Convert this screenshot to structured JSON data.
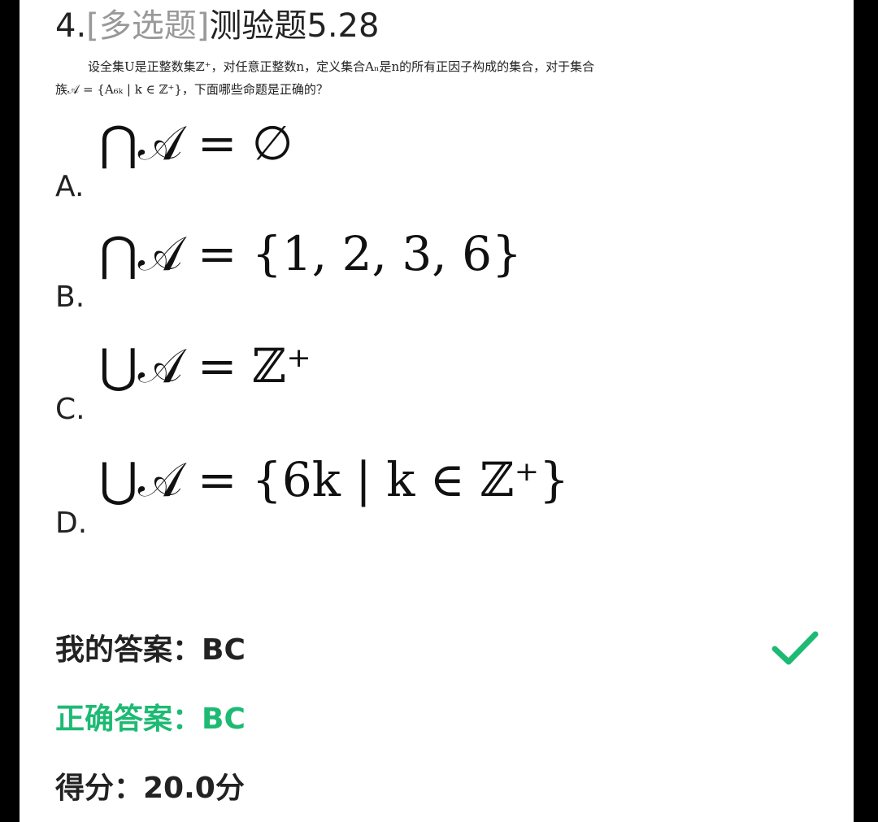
{
  "question": {
    "number": "4.",
    "type": "[多选题]",
    "title": "测验题5.28",
    "stem_line1": "设全集U是正整数集ℤ⁺，对任意正整数n，定义集合Aₙ是n的所有正因子构成的集合，对于集合",
    "stem_line2": "族𝒜 = {A₆ₖ | k ∈ ℤ⁺}，下面哪些命题是正确的？"
  },
  "options": [
    {
      "letter": "A.",
      "formula": "⋂𝒜 = ∅"
    },
    {
      "letter": "B.",
      "formula": "⋂𝒜 = {1, 2, 3, 6}"
    },
    {
      "letter": "C.",
      "formula": "⋃𝒜 = ℤ⁺"
    },
    {
      "letter": "D.",
      "formula": "⋃𝒜 = {6k | k ∈ ℤ⁺}"
    }
  ],
  "result": {
    "my_answer_label": "我的答案：BC",
    "correct_answer_label": "正确答案：BC",
    "score_label": "得分：20.0分",
    "status_icon": "check-icon",
    "correct_color": "#1dba73"
  }
}
